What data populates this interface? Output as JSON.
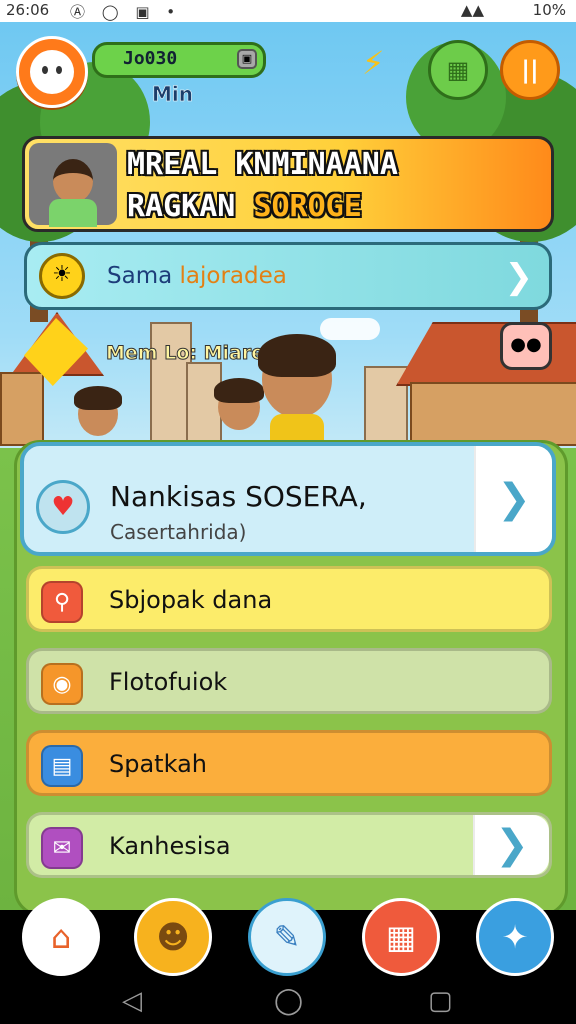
{
  "status_bar": {
    "time": "26:06",
    "icons": "Ⓐ ◯ ▣ •",
    "signal": "▲▲",
    "battery": "10%"
  },
  "header": {
    "xp_value": "Jo030",
    "sub_label": "Min",
    "shop_icon": "shop-icon",
    "pause_glyph": "||"
  },
  "banner": {
    "line1": "MREAL KNMINAANA",
    "line2_a": "RAGKAN ",
    "line2_b": "SOROGE"
  },
  "strip": {
    "text_a": "Sama ",
    "text_b": "lajoradea"
  },
  "scene": {
    "label": "Mem Lo: Miare"
  },
  "menu": {
    "featured": {
      "title": "Nankisas SOSERA,",
      "subtitle": "Casertahrida)"
    },
    "items": [
      {
        "label": "Sbjopak dana",
        "color": "#fcec6a",
        "icon_color": "#f05a3c"
      },
      {
        "label": "Flotofuiok",
        "color": "#cfe2a8",
        "icon_color": "#f5962a"
      },
      {
        "label": "Spatkah",
        "color": "#fbae3c",
        "icon_color": "#3a8de0"
      },
      {
        "label": "Kanhesisa",
        "color": "#d2eca6",
        "icon_color": "#b04fc0"
      }
    ]
  },
  "nav": {
    "items": [
      "home-icon",
      "profile-icon",
      "edit-icon",
      "book-icon",
      "bird-icon"
    ]
  },
  "colors": {
    "banner_accent": "#ffb21a",
    "sky": "#7fd4f5",
    "grass": "#8bc34a"
  }
}
